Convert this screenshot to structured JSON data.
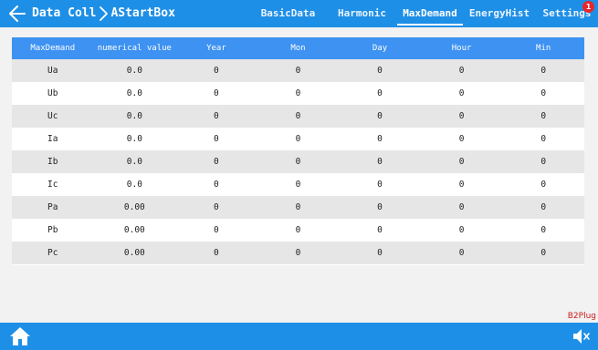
{
  "header": {
    "crumb_root": "Data Coll",
    "crumb_current": "AStartBox",
    "tabs": [
      {
        "label": "BasicData"
      },
      {
        "label": "Harmonic"
      },
      {
        "label": "MaxDemand"
      },
      {
        "label": "EnergyHist"
      },
      {
        "label": "Settings"
      }
    ],
    "settings_badge": "1"
  },
  "table": {
    "columns": [
      "MaxDemand",
      "numerical value",
      "Year",
      "Mon",
      "Day",
      "Hour",
      "Min"
    ],
    "rows": [
      [
        "Ua",
        "0.0",
        "0",
        "0",
        "0",
        "0",
        "0"
      ],
      [
        "Ub",
        "0.0",
        "0",
        "0",
        "0",
        "0",
        "0"
      ],
      [
        "Uc",
        "0.0",
        "0",
        "0",
        "0",
        "0",
        "0"
      ],
      [
        "Ia",
        "0.0",
        "0",
        "0",
        "0",
        "0",
        "0"
      ],
      [
        "Ib",
        "0.0",
        "0",
        "0",
        "0",
        "0",
        "0"
      ],
      [
        "Ic",
        "0.0",
        "0",
        "0",
        "0",
        "0",
        "0"
      ],
      [
        "Pa",
        "0.00",
        "0",
        "0",
        "0",
        "0",
        "0"
      ],
      [
        "Pb",
        "0.00",
        "0",
        "0",
        "0",
        "0",
        "0"
      ],
      [
        "Pc",
        "0.00",
        "0",
        "0",
        "0",
        "0",
        "0"
      ]
    ]
  },
  "footer": {
    "brand": "B2Plug"
  },
  "icons": {
    "back": "arrow-left-icon",
    "separator": "chevron-right-icon",
    "home": "home-icon",
    "mute": "speaker-mute-icon"
  },
  "colors": {
    "bar": "#1e8fe6",
    "header_row": "#3d92f2",
    "stripe": "#e6e6e6",
    "badge": "#e8262b",
    "brand": "#d01818"
  }
}
